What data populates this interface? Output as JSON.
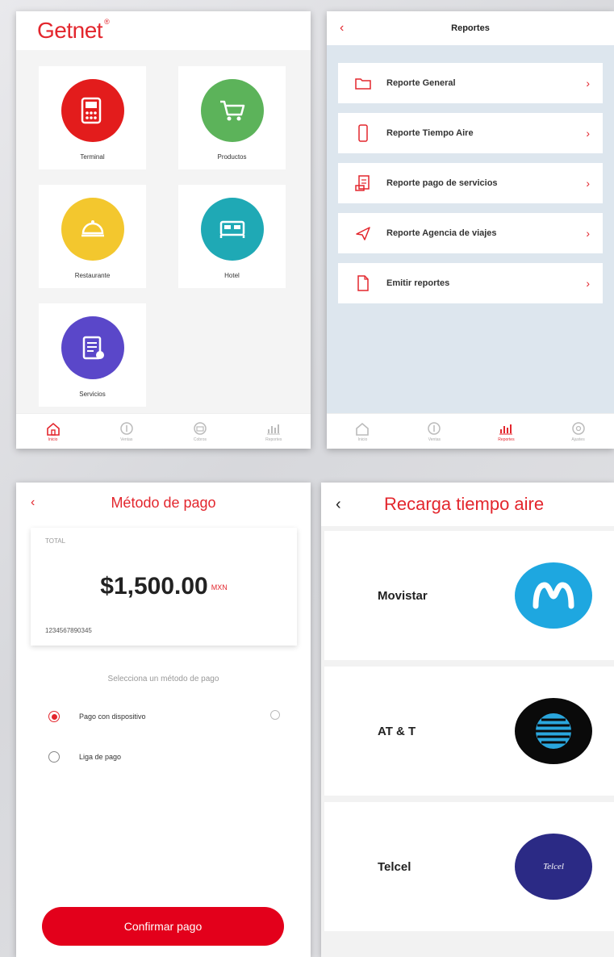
{
  "colors": {
    "brand_red": "#e3262d",
    "confirm_red": "#e3001b"
  },
  "home": {
    "brand": "Getnet",
    "brand_mark": "®",
    "tiles": [
      {
        "label": "Terminal",
        "icon": "terminal-icon",
        "color": "#e31c1c"
      },
      {
        "label": "Productos",
        "icon": "cart-icon",
        "color": "#5cb35a"
      },
      {
        "label": "Restaurante",
        "icon": "restaurant-icon",
        "color": "#f3c72e"
      },
      {
        "label": "Hotel",
        "icon": "bed-icon",
        "color": "#1fa9b5"
      },
      {
        "label": "Servicios",
        "icon": "services-icon",
        "color": "#5a47c9"
      }
    ],
    "tabs": [
      {
        "label": "Inicio",
        "icon": "home-icon",
        "active": true
      },
      {
        "label": "Ventas",
        "icon": "sales-icon",
        "active": false
      },
      {
        "label": "Cobros",
        "icon": "payments-icon",
        "active": false
      },
      {
        "label": "Reportes",
        "icon": "reports-icon",
        "active": false
      }
    ]
  },
  "reports": {
    "back": "‹",
    "title": "Reportes",
    "items": [
      {
        "label": "Reporte General",
        "icon": "folder-icon"
      },
      {
        "label": "Reporte Tiempo Aire",
        "icon": "phone-icon"
      },
      {
        "label": "Reporte pago de servicios",
        "icon": "bill-icon"
      },
      {
        "label": "Reporte Agencia de viajes",
        "icon": "plane-icon"
      },
      {
        "label": "Emitir reportes",
        "icon": "document-icon"
      }
    ],
    "tabs": [
      {
        "label": "Inicio",
        "icon": "home-icon",
        "active": false
      },
      {
        "label": "Ventas",
        "icon": "sales-icon",
        "active": false
      },
      {
        "label": "Reportes",
        "icon": "reports-icon",
        "active": true
      },
      {
        "label": "Ajustes",
        "icon": "settings-icon",
        "active": false
      }
    ]
  },
  "payment": {
    "back": "‹",
    "title": "Método de pago",
    "total_label": "TOTAL",
    "amount": "$1,500.00",
    "currency": "MXN",
    "reference": "1234567890345",
    "select_hint": "Selecciona un método de pago",
    "options": [
      {
        "label": "Pago con dispositivo",
        "selected": true
      },
      {
        "label": "Liga de pago",
        "selected": false
      }
    ],
    "confirm_label": "Confirmar pago"
  },
  "topup": {
    "back": "‹",
    "title": "Recarga tiempo aire",
    "carriers": [
      {
        "name": "Movistar",
        "logo": "movistar-logo",
        "color": "#1ea7e0"
      },
      {
        "name": "AT & T",
        "logo": "att-logo",
        "color": "#0a0a0a"
      },
      {
        "name": "Telcel",
        "logo": "telcel-logo",
        "color": "#2b2a85",
        "logo_text": "Telcel"
      }
    ]
  }
}
